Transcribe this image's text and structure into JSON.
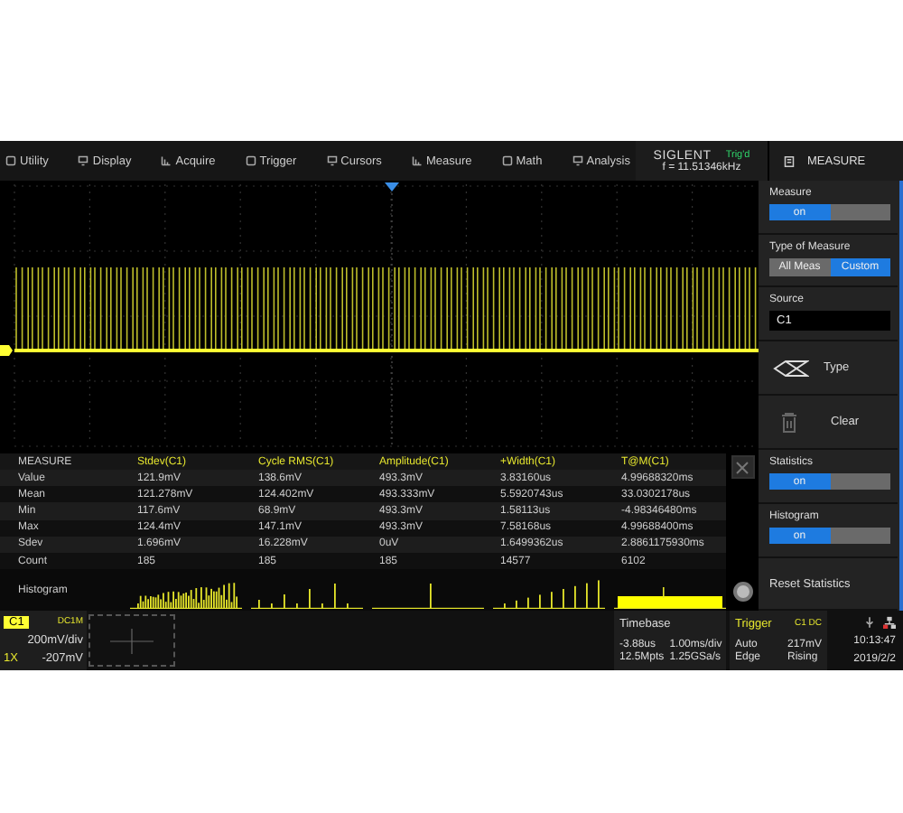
{
  "menu": [
    "Utility",
    "Display",
    "Acquire",
    "Trigger",
    "Cursors",
    "Measure",
    "Math",
    "Analysis"
  ],
  "brand": "SIGLENT",
  "trigger_status": "Trig'd",
  "frequency": "f = 11.51346kHz",
  "panel_title": "MEASURE",
  "side_panel": [
    {
      "kind": "toggle",
      "label": "Measure",
      "value": "on",
      "on": true
    },
    {
      "kind": "choice",
      "label": "Type of Measure",
      "options": [
        {
          "label": "All Meas",
          "selected": false
        },
        {
          "label": "Custom",
          "selected": true
        }
      ]
    },
    {
      "kind": "field",
      "label": "Source",
      "value": "C1"
    },
    {
      "kind": "action",
      "label": "Type"
    },
    {
      "kind": "action",
      "label": "Clear"
    },
    {
      "kind": "toggle",
      "label": "Statistics",
      "value": "on",
      "on": true
    },
    {
      "kind": "toggle",
      "label": "Histogram",
      "value": "on",
      "on": true
    },
    {
      "kind": "button",
      "label": "Reset Statistics"
    }
  ],
  "measure_table": {
    "columns": [
      "MEASURE",
      "Stdev(C1)",
      "Cycle RMS(C1)",
      "Amplitude(C1)",
      "+Width(C1)",
      "T@M(C1)"
    ],
    "rows": [
      [
        "Value",
        "121.9mV",
        "138.6mV",
        "493.3mV",
        "3.83160us",
        "4.99688320ms"
      ],
      [
        "Mean",
        "121.278mV",
        "124.402mV",
        "493.333mV",
        "5.5920743us",
        "33.0302178us"
      ],
      [
        "Min",
        "117.6mV",
        "68.9mV",
        "493.3mV",
        "1.58113us",
        "-4.98346480ms"
      ],
      [
        "Max",
        "124.4mV",
        "147.1mV",
        "493.3mV",
        "7.58168us",
        "4.99688400ms"
      ],
      [
        "Sdev",
        "1.696mV",
        "16.228mV",
        "0uV",
        "1.6499362us",
        "2.8861175930ms"
      ],
      [
        "Count",
        "185",
        "185",
        "185",
        "14577",
        "6102"
      ]
    ],
    "histogram_label": "Histogram"
  },
  "channel": {
    "name": "C1",
    "coupling": "DC1M",
    "scale": "200mV/div",
    "probe": "1X",
    "offset": "-207mV"
  },
  "timebase": {
    "title": "Timebase",
    "delay": "-3.88us",
    "scale": "1.00ms/div",
    "depth": "12.5Mpts",
    "rate": "1.25GSa/s"
  },
  "trigger": {
    "title": "Trigger",
    "source": "C1 DC",
    "mode": "Auto",
    "level": "217mV",
    "type": "Edge",
    "slope": "Rising"
  },
  "clock": {
    "time": "10:13:47",
    "date": "2019/2/2"
  }
}
